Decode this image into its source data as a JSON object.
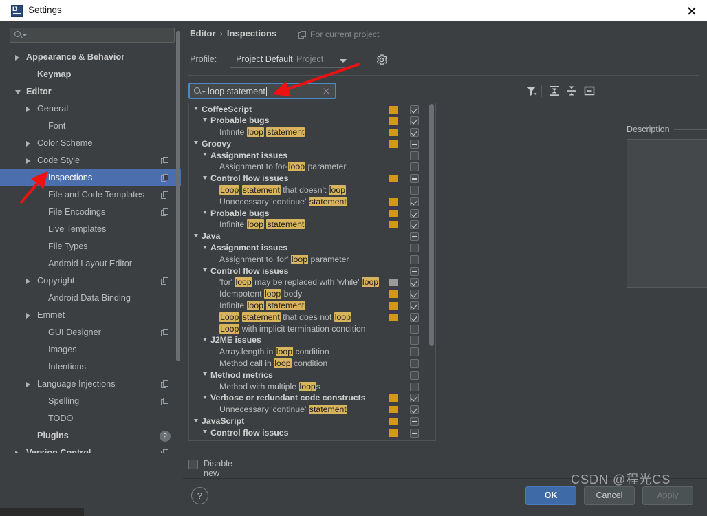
{
  "window": {
    "title": "Settings",
    "app_icon": "intellij-idea-icon",
    "close_icon": "close-icon"
  },
  "sidebar": {
    "search_placeholder": "",
    "search_icon": "search-icon",
    "items": [
      {
        "label": "Appearance & Behavior",
        "indent": 0,
        "arrow": "closed",
        "bold": true,
        "copy": false,
        "selected": false
      },
      {
        "label": "Keymap",
        "indent": 1,
        "arrow": "none",
        "bold": true,
        "copy": false,
        "selected": false
      },
      {
        "label": "Editor",
        "indent": 0,
        "arrow": "open",
        "bold": true,
        "copy": false,
        "selected": false
      },
      {
        "label": "General",
        "indent": 1,
        "arrow": "closed",
        "bold": false,
        "copy": false,
        "selected": false
      },
      {
        "label": "Font",
        "indent": 2,
        "arrow": "none",
        "bold": false,
        "copy": false,
        "selected": false
      },
      {
        "label": "Color Scheme",
        "indent": 1,
        "arrow": "closed",
        "bold": false,
        "copy": false,
        "selected": false
      },
      {
        "label": "Code Style",
        "indent": 1,
        "arrow": "closed",
        "bold": false,
        "copy": true,
        "selected": false
      },
      {
        "label": "Inspections",
        "indent": 2,
        "arrow": "none",
        "bold": false,
        "copy": true,
        "selected": true
      },
      {
        "label": "File and Code Templates",
        "indent": 2,
        "arrow": "none",
        "bold": false,
        "copy": true,
        "selected": false
      },
      {
        "label": "File Encodings",
        "indent": 2,
        "arrow": "none",
        "bold": false,
        "copy": true,
        "selected": false
      },
      {
        "label": "Live Templates",
        "indent": 2,
        "arrow": "none",
        "bold": false,
        "copy": false,
        "selected": false
      },
      {
        "label": "File Types",
        "indent": 2,
        "arrow": "none",
        "bold": false,
        "copy": false,
        "selected": false
      },
      {
        "label": "Android Layout Editor",
        "indent": 2,
        "arrow": "none",
        "bold": false,
        "copy": false,
        "selected": false
      },
      {
        "label": "Copyright",
        "indent": 1,
        "arrow": "closed",
        "bold": false,
        "copy": true,
        "selected": false
      },
      {
        "label": "Android Data Binding",
        "indent": 2,
        "arrow": "none",
        "bold": false,
        "copy": false,
        "selected": false
      },
      {
        "label": "Emmet",
        "indent": 1,
        "arrow": "closed",
        "bold": false,
        "copy": false,
        "selected": false
      },
      {
        "label": "GUI Designer",
        "indent": 2,
        "arrow": "none",
        "bold": false,
        "copy": true,
        "selected": false
      },
      {
        "label": "Images",
        "indent": 2,
        "arrow": "none",
        "bold": false,
        "copy": false,
        "selected": false
      },
      {
        "label": "Intentions",
        "indent": 2,
        "arrow": "none",
        "bold": false,
        "copy": false,
        "selected": false
      },
      {
        "label": "Language Injections",
        "indent": 1,
        "arrow": "closed",
        "bold": false,
        "copy": true,
        "selected": false
      },
      {
        "label": "Spelling",
        "indent": 2,
        "arrow": "none",
        "bold": false,
        "copy": true,
        "selected": false
      },
      {
        "label": "TODO",
        "indent": 2,
        "arrow": "none",
        "bold": false,
        "copy": false,
        "selected": false
      },
      {
        "label": "Plugins",
        "indent": 1,
        "arrow": "none",
        "bold": true,
        "copy": false,
        "selected": false,
        "badge": "2"
      },
      {
        "label": "Version Control",
        "indent": 0,
        "arrow": "closed",
        "bold": true,
        "copy": true,
        "selected": false
      }
    ]
  },
  "header": {
    "breadcrumb_1": "Editor",
    "breadcrumb_sep": "›",
    "breadcrumb_2": "Inspections",
    "for_current_project": "For current project",
    "scope_icon": "copy-icon"
  },
  "profile": {
    "label": "Profile:",
    "value": "Project Default",
    "scope": "Project",
    "gear_icon": "gear-icon",
    "dropdown_icon": "chevron-down-icon"
  },
  "search": {
    "value": "loop statement",
    "search_icon": "search-icon",
    "clear_icon": "clear-icon"
  },
  "toolbar": {
    "filter_icon": "filter-icon",
    "expand_all_icon": "expand-all-icon",
    "collapse_all_icon": "collapse-all-icon",
    "reset_icon": "reset-to-default-icon"
  },
  "inspections": {
    "highlight_terms": [
      "loop",
      "Loop",
      "statement",
      "loops"
    ],
    "rows": [
      {
        "text": "CoffeeScript",
        "indent": 0,
        "arrow": "open",
        "group": true,
        "severity": "yellow",
        "check": "on"
      },
      {
        "text": "Probable bugs",
        "indent": 1,
        "arrow": "open",
        "group": true,
        "severity": "yellow",
        "check": "on"
      },
      {
        "text": "Infinite [loop] [statement]",
        "indent": 2,
        "arrow": "none",
        "group": false,
        "severity": "yellow",
        "check": "on"
      },
      {
        "text": "Groovy",
        "indent": 0,
        "arrow": "open",
        "group": true,
        "severity": "yellow",
        "check": "dash"
      },
      {
        "text": "Assignment issues",
        "indent": 1,
        "arrow": "open",
        "group": true,
        "severity": "none",
        "check": "off"
      },
      {
        "text": "Assignment to for-[loop] parameter",
        "indent": 2,
        "arrow": "none",
        "group": false,
        "severity": "none",
        "check": "off"
      },
      {
        "text": "Control flow issues",
        "indent": 1,
        "arrow": "open",
        "group": true,
        "severity": "yellow",
        "check": "dash"
      },
      {
        "text": "[Loop] [statement] that doesn't [loop]",
        "indent": 2,
        "arrow": "none",
        "group": false,
        "severity": "none",
        "check": "off"
      },
      {
        "text": "Unnecessary 'continue' [statement]",
        "indent": 2,
        "arrow": "none",
        "group": false,
        "severity": "yellow",
        "check": "on"
      },
      {
        "text": "Probable bugs",
        "indent": 1,
        "arrow": "open",
        "group": true,
        "severity": "yellow",
        "check": "on"
      },
      {
        "text": "Infinite [loop] [statement]",
        "indent": 2,
        "arrow": "none",
        "group": false,
        "severity": "yellow",
        "check": "on"
      },
      {
        "text": "Java",
        "indent": 0,
        "arrow": "open",
        "group": true,
        "severity": "none",
        "check": "dash"
      },
      {
        "text": "Assignment issues",
        "indent": 1,
        "arrow": "open",
        "group": true,
        "severity": "none",
        "check": "off"
      },
      {
        "text": "Assignment to 'for' [loop] parameter",
        "indent": 2,
        "arrow": "none",
        "group": false,
        "severity": "none",
        "check": "off"
      },
      {
        "text": "Control flow issues",
        "indent": 1,
        "arrow": "open",
        "group": true,
        "severity": "none",
        "check": "dash"
      },
      {
        "text": "'for' [loop] may be replaced with 'while' [loop]",
        "indent": 2,
        "arrow": "none",
        "group": false,
        "severity": "gray",
        "check": "on"
      },
      {
        "text": "Idempotent [loop] body",
        "indent": 2,
        "arrow": "none",
        "group": false,
        "severity": "yellow",
        "check": "on"
      },
      {
        "text": "Infinite [loop] [statement]",
        "indent": 2,
        "arrow": "none",
        "group": false,
        "severity": "yellow",
        "check": "on"
      },
      {
        "text": "[Loop] [statement] that does not [loop]",
        "indent": 2,
        "arrow": "none",
        "group": false,
        "severity": "yellow",
        "check": "on"
      },
      {
        "text": "[Loop] with implicit termination condition",
        "indent": 2,
        "arrow": "none",
        "group": false,
        "severity": "none",
        "check": "off"
      },
      {
        "text": "J2ME issues",
        "indent": 1,
        "arrow": "open",
        "group": true,
        "severity": "none",
        "check": "off"
      },
      {
        "text": "Array.length in [loop] condition",
        "indent": 2,
        "arrow": "none",
        "group": false,
        "severity": "none",
        "check": "off"
      },
      {
        "text": "Method call in [loop] condition",
        "indent": 2,
        "arrow": "none",
        "group": false,
        "severity": "none",
        "check": "off"
      },
      {
        "text": "Method metrics",
        "indent": 1,
        "arrow": "open",
        "group": true,
        "severity": "none",
        "check": "off"
      },
      {
        "text": "Method with multiple [loop]s",
        "indent": 2,
        "arrow": "none",
        "group": false,
        "severity": "none",
        "check": "off"
      },
      {
        "text": "Verbose or redundant code constructs",
        "indent": 1,
        "arrow": "open",
        "group": true,
        "severity": "yellow",
        "check": "on"
      },
      {
        "text": "Unnecessary 'continue' [statement]",
        "indent": 2,
        "arrow": "none",
        "group": false,
        "severity": "yellow",
        "check": "on"
      },
      {
        "text": "JavaScript",
        "indent": 0,
        "arrow": "open",
        "group": true,
        "severity": "yellow",
        "check": "dash"
      },
      {
        "text": "Control flow issues",
        "indent": 1,
        "arrow": "open",
        "group": true,
        "severity": "yellow",
        "check": "dash"
      }
    ]
  },
  "description": {
    "title": "Description",
    "body": ""
  },
  "options": {
    "disable_new_label": "Disable new inspections by default",
    "disable_new_checked": false
  },
  "footer": {
    "help_label": "?",
    "ok_label": "OK",
    "cancel_label": "Cancel",
    "apply_label": "Apply"
  },
  "watermark": {
    "text": "CSDN @程光CS"
  },
  "colors": {
    "window_bg": "#3c3f41",
    "titlebar_bg": "#ffffff",
    "selection_blue": "#4b6eaf",
    "focus_blue": "#4a88c7",
    "ok_button": "#3f6aa8",
    "severity_warning": "#cf9b14",
    "severity_gray": "#9a9a9a",
    "highlight_match": "#d8b45c",
    "annotation_arrow": "#ee1111"
  }
}
